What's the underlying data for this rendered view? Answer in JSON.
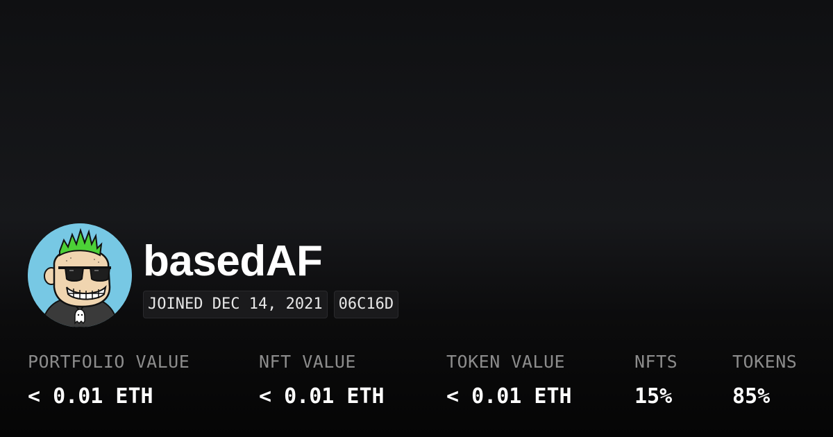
{
  "profile": {
    "username": "basedAF",
    "joined": "JOINED DEC 14, 2021",
    "color_code": "06C16D",
    "avatar_icon": "punk-avatar-icon"
  },
  "stats": [
    {
      "label": "PORTFOLIO VALUE",
      "value": "< 0.01 ETH"
    },
    {
      "label": "NFT VALUE",
      "value": "< 0.01 ETH"
    },
    {
      "label": "TOKEN VALUE",
      "value": "< 0.01 ETH"
    },
    {
      "label": "NFTS",
      "value": "15%"
    },
    {
      "label": "TOKENS",
      "value": "85%"
    }
  ],
  "colors": {
    "background_top": "#0f1012",
    "background_bottom": "#050505",
    "avatar_background": "#77c8e4",
    "mohawk": "#4cd137",
    "label_text": "#8c8c8c",
    "value_text": "#ffffff"
  }
}
